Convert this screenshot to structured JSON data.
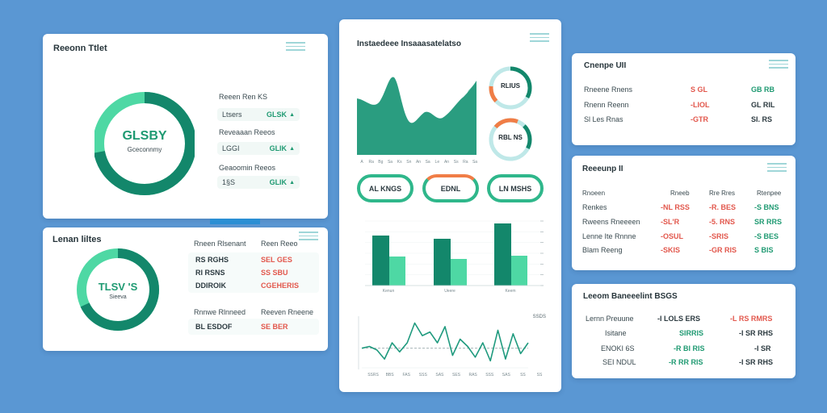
{
  "card1": {
    "title": "Reeonn Ttlet",
    "donut": {
      "value": "GLSBY",
      "label": "Gceconnmy",
      "fraction": 0.72
    },
    "header": "Reeen Ren KS",
    "rows": [
      {
        "label": "Ltsers",
        "value": "GLSK"
      },
      {
        "label": "Reveaaan Reeos",
        "value": ""
      },
      {
        "label": "LGGI",
        "value": "GLIK"
      },
      {
        "label": "Geaoomin Reeos",
        "value": ""
      },
      {
        "label": "1§S",
        "value": "GLIK"
      }
    ]
  },
  "card2": {
    "title": "Lenan liltes",
    "donut": {
      "value": "TLSV 'S",
      "label": "Sieeva",
      "fraction": 0.68
    },
    "col1_header": "Rneen Rlsenant",
    "col2_header": "Reen Reeo",
    "rows": [
      {
        "a": "RS RGHS",
        "b": "SEL GES"
      },
      {
        "a": "RI RSNS",
        "b": "SS SBU"
      },
      {
        "a": "DDIROIK",
        "b": "CGEHERIS"
      }
    ],
    "sub_col1": "Rnnwe Rlnneed",
    "sub_col2": "Reeven Rneene",
    "sub_row": {
      "a": "BL ESDOF",
      "b": "SE BER"
    }
  },
  "card3": {
    "title": "Instaedeee Insaaasatelatso",
    "area_ticks": [
      "A",
      "Ra",
      "Bg",
      "Sa",
      "Ks",
      "Sn",
      "An",
      "Sa",
      "Le",
      "An",
      "Ss",
      "Ra",
      "Sa"
    ],
    "ring_labels": [
      "RLIUS",
      "RBL NS"
    ],
    "ovals": [
      "AL KNGS",
      "EDNL",
      "LN MSHS"
    ],
    "bar_values": [
      {
        "dark": 62,
        "light": 36
      },
      {
        "dark": 58,
        "light": 33
      },
      {
        "dark": 77,
        "light": 37
      }
    ],
    "bar_ylim": [
      0,
      80
    ],
    "bar_ticks": [
      "Kenun",
      "Ueere",
      "Keem"
    ],
    "line_values": [
      0,
      1,
      -1,
      -6,
      3,
      -2,
      3,
      14,
      7,
      9,
      3,
      12,
      -4,
      5,
      1,
      -5,
      3,
      -7,
      10,
      -6,
      8,
      -3,
      3
    ],
    "line_ylim": [
      -10,
      16
    ],
    "line_tag": "SSDS",
    "line_ticks": [
      "SSRS",
      "BBS",
      "FAS",
      "SSS",
      "SAS",
      "SES",
      "RAS",
      "SSS",
      "SAS",
      "SS",
      "SS"
    ]
  },
  "card4": {
    "title": "Cnenpe UII",
    "rows": [
      {
        "label": "Rneene Rnens",
        "v1": "S GL",
        "v2": "GB RB"
      },
      {
        "label": "Rnenn Reenn",
        "v1": "-LIOL",
        "v2": "GL RIL"
      },
      {
        "label": "Sl Les Rnas",
        "v1": "-GTR",
        "v2": "SI. RS"
      }
    ]
  },
  "card5": {
    "title": "Reeeunp II",
    "headers": [
      "Rnoeen",
      "Rneeb",
      "Rre Rres",
      "Rtenpee"
    ],
    "rows": [
      {
        "label": "Renkes",
        "v1": "-NL RSS",
        "v2": "-R. BES",
        "v3": "-S BNS"
      },
      {
        "label": "Rweens Rneeeen",
        "v1": "-SL'R",
        "v2": "-5. RNS",
        "v3": "SR RRS"
      },
      {
        "label": "Lenne Ite Rnnne",
        "v1": "-OSUL",
        "v2": "-SRIS",
        "v3": "-S BES"
      },
      {
        "label": "Blam Reeng",
        "v1": "-SKIS",
        "v2": "-GR RIS",
        "v3": "S BIS"
      }
    ]
  },
  "card6": {
    "title": "Leeom Baneeelint BSGS",
    "rows": [
      {
        "label": "Lernn Preuune",
        "v1": "-I LOLS ERS",
        "v2": "-L RS RMRS"
      },
      {
        "label": "Isitane",
        "v1": "SIRRIS",
        "v2": "-I SR RHS"
      },
      {
        "label": "ENOKI 6S",
        "v1": "-R BI RIS",
        "v2": "-I SR"
      },
      {
        "label": "SEI NDUL",
        "v1": "-R RR RIS",
        "v2": "-I SR RHS"
      }
    ]
  },
  "colors": {
    "teal_dark": "#13876b",
    "teal_light": "#4ed8a4",
    "green_text": "#1f9a72",
    "red_text": "#e2574c",
    "background": "#5a97d3"
  }
}
